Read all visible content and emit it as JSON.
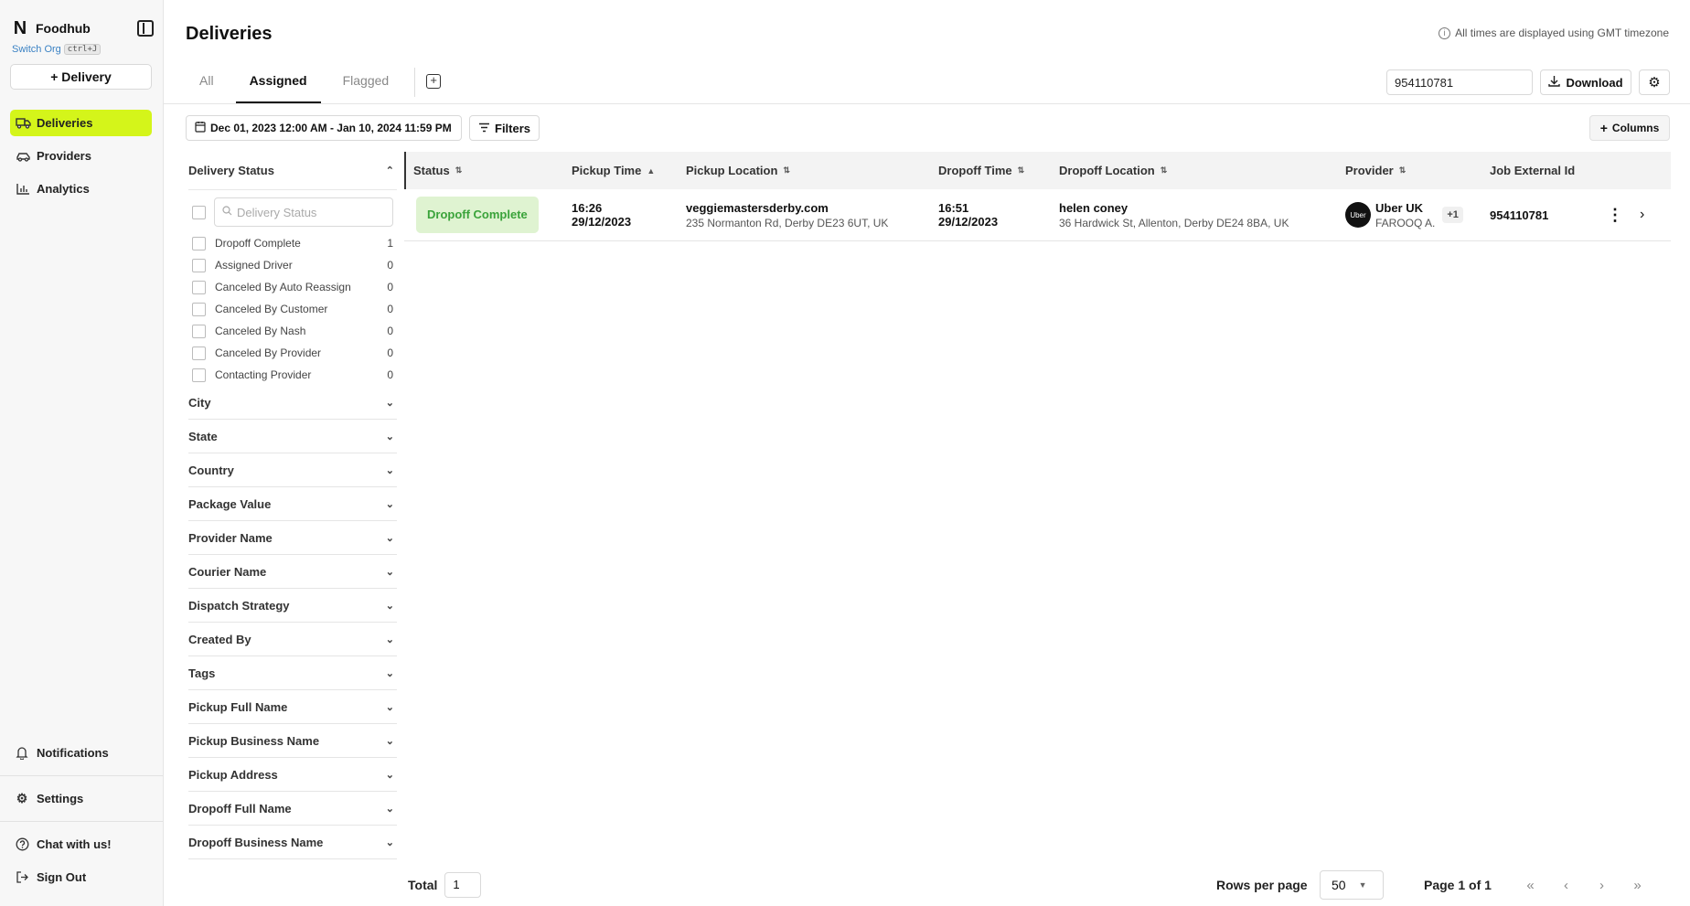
{
  "sidebar": {
    "brand": "Foodhub",
    "switch_org": "Switch Org",
    "shortcut": "ctrl+J",
    "new_delivery": "+ Delivery",
    "nav": [
      {
        "label": "Deliveries",
        "icon": "truck-icon"
      },
      {
        "label": "Providers",
        "icon": "car-icon"
      },
      {
        "label": "Analytics",
        "icon": "bar-chart-icon"
      }
    ],
    "bottom": {
      "notifications": "Notifications",
      "settings": "Settings",
      "chat": "Chat with us!",
      "sign_out": "Sign Out"
    },
    "active_color": "#d4f51a"
  },
  "header": {
    "title": "Deliveries",
    "tz_note": "All times are displayed using GMT timezone",
    "tabs": [
      "All",
      "Assigned",
      "Flagged"
    ],
    "active_tab": "Assigned",
    "search_value": "954110781",
    "download": "Download"
  },
  "toolbar": {
    "date_range": "Dec 01, 2023 12:00 AM - Jan 10, 2024 11:59 PM",
    "filters": "Filters",
    "columns": "Columns"
  },
  "filters": {
    "delivery_status": {
      "title": "Delivery Status",
      "search_placeholder": "Delivery Status",
      "options": [
        {
          "label": "Dropoff Complete",
          "count": "1"
        },
        {
          "label": "Assigned Driver",
          "count": "0"
        },
        {
          "label": "Canceled By Auto Reassign",
          "count": "0"
        },
        {
          "label": "Canceled By Customer",
          "count": "0"
        },
        {
          "label": "Canceled By Nash",
          "count": "0"
        },
        {
          "label": "Canceled By Provider",
          "count": "0"
        },
        {
          "label": "Contacting Provider",
          "count": "0"
        }
      ]
    },
    "sections": [
      "City",
      "State",
      "Country",
      "Package Value",
      "Provider Name",
      "Courier Name",
      "Dispatch Strategy",
      "Created By",
      "Tags",
      "Pickup Full Name",
      "Pickup Business Name",
      "Pickup Address",
      "Dropoff Full Name",
      "Dropoff Business Name"
    ]
  },
  "table": {
    "columns": [
      "Status",
      "Pickup Time",
      "Pickup Location",
      "Dropoff Time",
      "Dropoff Location",
      "Provider",
      "Job External Id"
    ],
    "rows": [
      {
        "status": "Dropoff Complete",
        "pickup_time": "16:26",
        "pickup_date": "29/12/2023",
        "pickup_name": "veggiemastersderby.com",
        "pickup_address": "235 Normanton Rd, Derby DE23 6UT, UK",
        "dropoff_time": "16:51",
        "dropoff_date": "29/12/2023",
        "dropoff_name": "helen coney",
        "dropoff_address": "36 Hardwick St, Allenton, Derby DE24 8BA, UK",
        "provider": "Uber UK",
        "provider_logo": "Uber",
        "courier": "FAROOQ A.",
        "extra_providers": "+1",
        "job_external_id": "954110781"
      }
    ],
    "status_colors": {
      "bg": "#dff3d1",
      "text": "#3aa33a"
    }
  },
  "footer": {
    "total_label": "Total",
    "total_value": "1",
    "rows_per_page_label": "Rows per page",
    "rows_per_page_value": "50",
    "page_info": "Page 1 of 1"
  }
}
